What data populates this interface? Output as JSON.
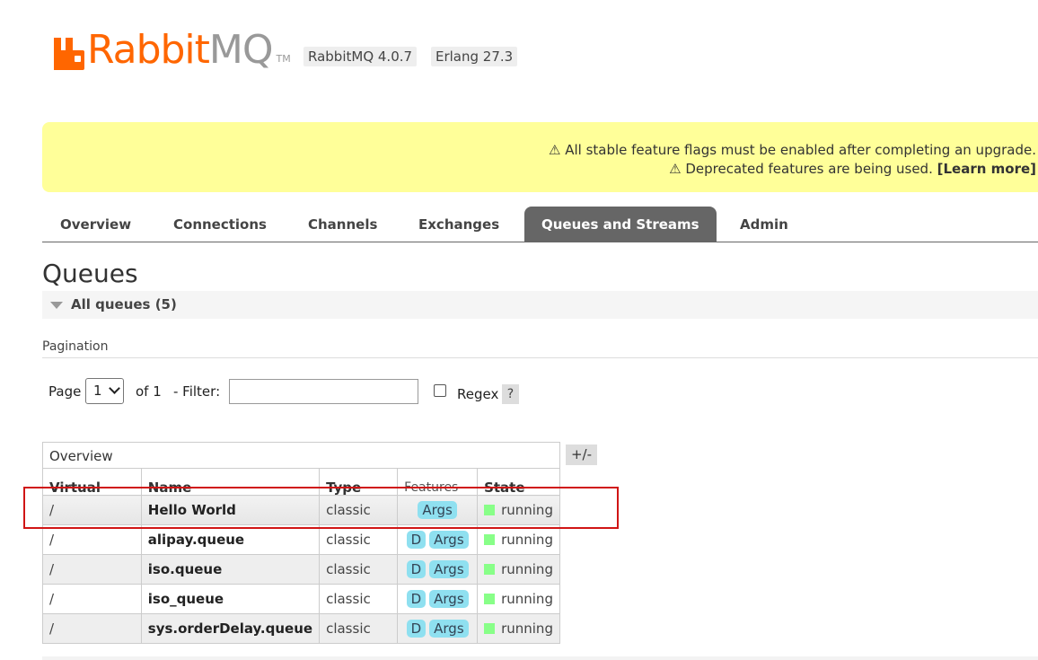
{
  "header": {
    "logo_text_rabbit": "Rabbit",
    "logo_text_mq": "MQ",
    "logo_tm": "TM",
    "version_rabbitmq": "RabbitMQ 4.0.7",
    "version_erlang": "Erlang 27.3"
  },
  "banner": {
    "line1": "⚠ All stable feature flags must be enabled after completing an upgrade.",
    "line2": "⚠ Deprecated features are being used. ",
    "learn_more": "[Learn more]"
  },
  "tabs": [
    {
      "label": "Overview"
    },
    {
      "label": "Connections"
    },
    {
      "label": "Channels"
    },
    {
      "label": "Exchanges"
    },
    {
      "label": "Queues and Streams",
      "active": true
    },
    {
      "label": "Admin"
    }
  ],
  "page": {
    "title": "Queues",
    "section_label": "All queues (5)",
    "pagination_label": "Pagination"
  },
  "controls": {
    "page_label": "Page",
    "page_value": "1",
    "of_label": "of 1",
    "filter_label": "- Filter:",
    "filter_value": "",
    "regex_label": "Regex",
    "help_label": "?",
    "toggle_columns": "+/-"
  },
  "table": {
    "group_header": "Overview",
    "columns": [
      "Virtual host",
      "Name",
      "Type",
      "Features",
      "State"
    ],
    "rows": [
      {
        "vhost": "/",
        "name": "Hello World",
        "type": "classic",
        "durable": "",
        "args": "Args",
        "state": "running"
      },
      {
        "vhost": "/",
        "name": "alipay.queue",
        "type": "classic",
        "durable": "D",
        "args": "Args",
        "state": "running"
      },
      {
        "vhost": "/",
        "name": "iso.queue",
        "type": "classic",
        "durable": "D",
        "args": "Args",
        "state": "running"
      },
      {
        "vhost": "/",
        "name": "iso_queue",
        "type": "classic",
        "durable": "D",
        "args": "Args",
        "state": "running"
      },
      {
        "vhost": "/",
        "name": "sys.orderDelay.queue",
        "type": "classic",
        "durable": "D",
        "args": "Args",
        "state": "running"
      }
    ]
  },
  "colors": {
    "brand_orange": "#ff6600",
    "banner_yellow": "#ffff99",
    "active_tab": "#666666",
    "feature_tag": "#8fe0f0",
    "state_running": "#88ff88",
    "highlight_red": "#d01515"
  }
}
